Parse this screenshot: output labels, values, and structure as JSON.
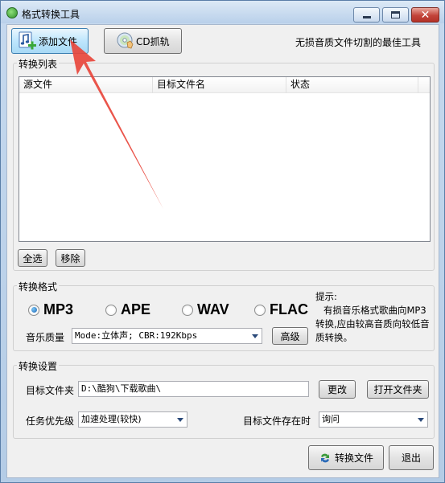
{
  "window": {
    "title": "格式转换工具"
  },
  "toolbar": {
    "add_file": "添加文件",
    "cd_rip": "CD抓轨",
    "slogan": "无损音质文件切割的最佳工具"
  },
  "list_section": {
    "label": "转换列表",
    "columns": [
      "源文件",
      "目标文件名",
      "状态"
    ],
    "select_all": "全选",
    "remove": "移除"
  },
  "format_section": {
    "label": "转换格式",
    "formats": [
      "MP3",
      "APE",
      "WAV",
      "FLAC"
    ],
    "selected": "MP3",
    "quality_label": "音乐质量",
    "quality_value": "Mode:立体声; CBR:192Kbps",
    "advanced": "高级",
    "hint_title": "提示:",
    "hint_text": "有损音乐格式歌曲向MP3转换,应由较高音质向较低音质转换。"
  },
  "settings_section": {
    "label": "转换设置",
    "target_folder_label": "目标文件夹",
    "target_folder_value": "D:\\酷狗\\下载歌曲\\",
    "change": "更改",
    "open_folder": "打开文件夹",
    "priority_label": "任务优先级",
    "priority_value": "加速处理(较快)",
    "exists_label": "目标文件存在时",
    "exists_value": "询问"
  },
  "footer": {
    "convert": "转换文件",
    "exit": "退出"
  },
  "colors": {
    "arrow": "#e8463c",
    "accent": "#3c7fb1"
  }
}
